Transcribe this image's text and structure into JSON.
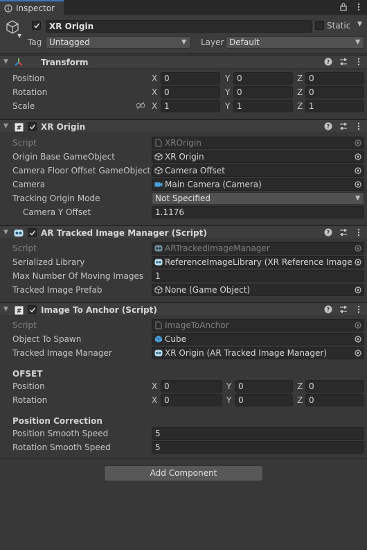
{
  "tab": {
    "label": "Inspector"
  },
  "header": {
    "name": "XR Origin",
    "static_label": "Static",
    "tag_label": "Tag",
    "tag_value": "Untagged",
    "layer_label": "Layer",
    "layer_value": "Default"
  },
  "transform": {
    "title": "Transform",
    "position_label": "Position",
    "rotation_label": "Rotation",
    "scale_label": "Scale",
    "axes": [
      "X",
      "Y",
      "Z"
    ],
    "position": [
      "0",
      "0",
      "0"
    ],
    "rotation": [
      "0",
      "0",
      "0"
    ],
    "scale": [
      "1",
      "1",
      "1"
    ]
  },
  "xr_origin": {
    "title": "XR Origin",
    "script_label": "Script",
    "script_value": "XROrigin",
    "origin_label": "Origin Base GameObject",
    "origin_value": "XR Origin",
    "floor_label": "Camera Floor Offset GameObject",
    "floor_value": "Camera Offset",
    "camera_label": "Camera",
    "camera_value": "Main Camera (Camera)",
    "tracking_label": "Tracking Origin Mode",
    "tracking_value": "Not Specified",
    "yoffset_label": "Camera Y Offset",
    "yoffset_value": "1.1176"
  },
  "ar_manager": {
    "title": "AR Tracked Image Manager (Script)",
    "script_label": "Script",
    "script_value": "ARTrackedImageManager",
    "library_label": "Serialized Library",
    "library_value": "ReferenceImageLibrary (XR Reference Image Lib",
    "max_label": "Max Number Of Moving Images",
    "max_value": "1",
    "prefab_label": "Tracked Image Prefab",
    "prefab_value": "None (Game Object)"
  },
  "image_to_anchor": {
    "title": "Image To Anchor (Script)",
    "script_label": "Script",
    "script_value": "ImageToAnchor",
    "spawn_label": "Object To Spawn",
    "spawn_value": "Cube",
    "manager_label": "Tracked Image Manager",
    "manager_value": "XR Origin (AR Tracked Image Manager)",
    "ofset_heading": "OFSET",
    "position_label": "Position",
    "rotation_label": "Rotation",
    "position": [
      "0",
      "0",
      "0"
    ],
    "rotation": [
      "0",
      "0",
      "0"
    ],
    "correction_heading": "Position Correction",
    "pos_smooth_label": "Position Smooth Speed",
    "pos_smooth_value": "5",
    "rot_smooth_label": "Rotation Smooth Speed",
    "rot_smooth_value": "5"
  },
  "add_component_label": "Add Component",
  "colors": {
    "background": "#383838",
    "field": "#2a2a2a",
    "accent": "#3a79bb"
  }
}
